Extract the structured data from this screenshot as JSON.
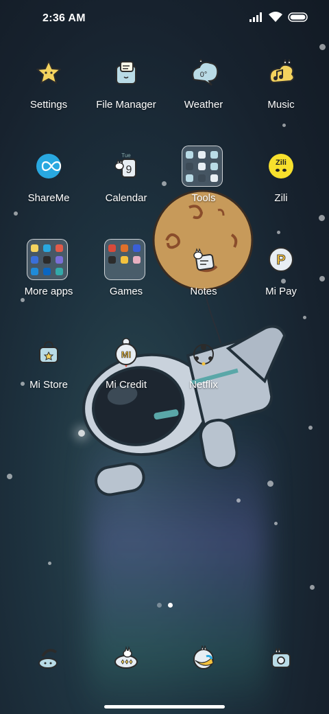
{
  "status_bar": {
    "time": "2:36 AM",
    "icons": [
      "signal-icon",
      "wifi-icon",
      "battery-icon"
    ]
  },
  "home": {
    "apps": [
      {
        "name": "settings",
        "label": "Settings",
        "icon": "star-icon"
      },
      {
        "name": "file-manager",
        "label": "File Manager",
        "icon": "folder-icon"
      },
      {
        "name": "weather",
        "label": "Weather",
        "icon": "cloud-icon",
        "icon_text": "0°"
      },
      {
        "name": "music",
        "label": "Music",
        "icon": "music-note-icon"
      },
      {
        "name": "shareme",
        "label": "ShareMe",
        "icon": "infinity-icon"
      },
      {
        "name": "calendar",
        "label": "Calendar",
        "icon": "calendar-icon",
        "icon_text": "Tue",
        "day": "9"
      },
      {
        "name": "tools",
        "label": "Tools",
        "icon": "folder-icon",
        "folder": true
      },
      {
        "name": "zili",
        "label": "Zili",
        "icon": "zili-icon",
        "icon_text": "Zili"
      },
      {
        "name": "more-apps",
        "label": "More apps",
        "icon": "folder-icon",
        "folder": true
      },
      {
        "name": "games",
        "label": "Games",
        "icon": "folder-icon",
        "folder": true
      },
      {
        "name": "notes",
        "label": "Notes",
        "icon": "note-icon"
      },
      {
        "name": "mi-pay",
        "label": "Mi Pay",
        "icon": "payment-icon",
        "icon_text": "P"
      },
      {
        "name": "mi-store",
        "label": "Mi Store",
        "icon": "shopping-bag-icon"
      },
      {
        "name": "mi-credit",
        "label": "Mi Credit",
        "icon": "credit-icon",
        "icon_text": "MI"
      },
      {
        "name": "netflix",
        "label": "Netflix",
        "icon": "bomb-icon"
      }
    ],
    "page_indicator": {
      "pages": 2,
      "current": 2
    }
  },
  "dock": {
    "items": [
      "phone-icon",
      "messages-icon",
      "browser-icon",
      "camera-icon"
    ]
  },
  "colors": {
    "accent_yellow": "#f4d35e",
    "accent_blue": "#29a8e0",
    "label_text": "#ffffff"
  }
}
